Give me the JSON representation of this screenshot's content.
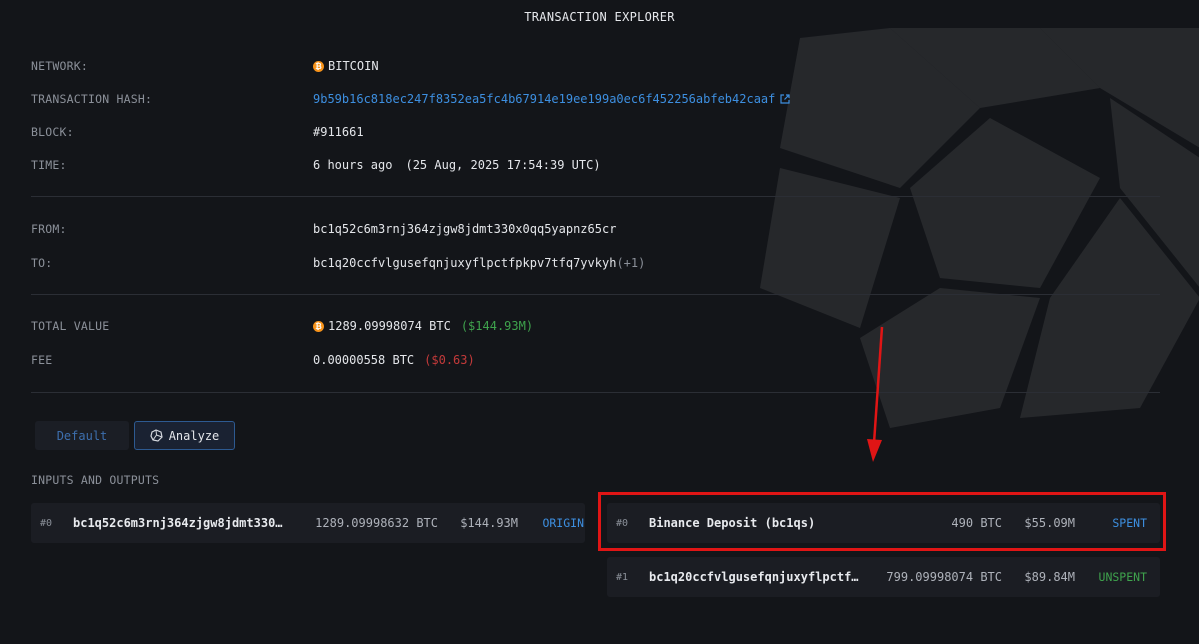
{
  "header": {
    "title": "TRANSACTION EXPLORER"
  },
  "details": {
    "network": {
      "label": "NETWORK:",
      "value": "BITCOIN"
    },
    "tx_hash": {
      "label": "TRANSACTION HASH:",
      "value": "9b59b16c818ec247f8352ea5fc4b67914e19ee199a0ec6f452256abfeb42caaf"
    },
    "block": {
      "label": "BLOCK:",
      "value": "#911661"
    },
    "time": {
      "label": "TIME:",
      "relative": "6 hours ago",
      "absolute": "(25 Aug, 2025 17:54:39 UTC)"
    },
    "from": {
      "label": "FROM:",
      "value": "bc1q52c6m3rnj364zjgw8jdmt330x0qq5yapnz65cr"
    },
    "to": {
      "label": "TO:",
      "value": "bc1q20ccfvlgusefqnjuxyflpctfpkpv7tfq7yvkyh",
      "extra": "(+1)"
    },
    "total_value": {
      "label": "TOTAL VALUE",
      "btc": "1289.09998074 BTC",
      "usd": "($144.93M)"
    },
    "fee": {
      "label": "FEE",
      "btc": "0.00000558 BTC",
      "usd": "($0.63)"
    }
  },
  "tabs": {
    "default": "Default",
    "analyze": "Analyze"
  },
  "io": {
    "section_label": "INPUTS AND OUTPUTS",
    "inputs": [
      {
        "index": "#0",
        "address": "bc1q52c6m3rnj364zjgw8jdmt330…",
        "amount": "1289.09998632 BTC",
        "usd": "$144.93M",
        "status": "ORIGIN"
      }
    ],
    "outputs": [
      {
        "index": "#0",
        "address": "Binance Deposit (bc1qs)",
        "amount": "490 BTC",
        "usd": "$55.09M",
        "status": "SPENT"
      },
      {
        "index": "#1",
        "address": "bc1q20ccfvlgusefqnjuxyflpctfp…",
        "amount": "799.09998074 BTC",
        "usd": "$89.84M",
        "status": "UNSPENT"
      }
    ]
  },
  "icons": {
    "network": "bitcoin-icon",
    "hash_link": "external-link-icon",
    "analyze": "arkham-logo-icon"
  },
  "colors": {
    "accent_blue": "#3d8fe0",
    "positive": "#3fa34d",
    "negative": "#c43a3a",
    "bitcoin": "#f7931a",
    "annotation": "#e01515"
  }
}
